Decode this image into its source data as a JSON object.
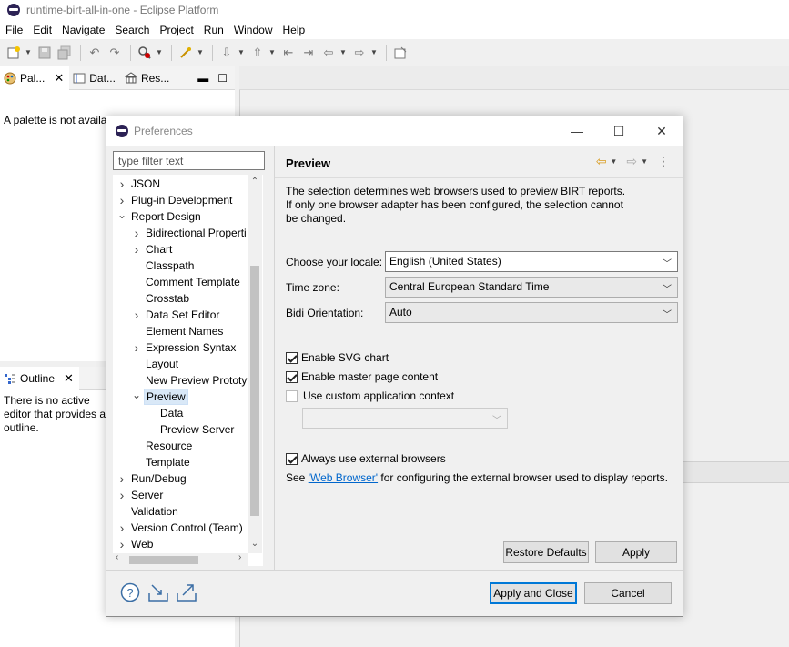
{
  "window": {
    "title": "runtime-birt-all-in-one - Eclipse Platform"
  },
  "menu": [
    "File",
    "Edit",
    "Navigate",
    "Search",
    "Project",
    "Run",
    "Window",
    "Help"
  ],
  "views": {
    "top_tabs": [
      {
        "label": "Pal...",
        "icon": "palette-icon"
      },
      {
        "label": "Dat...",
        "icon": "data-explorer-icon"
      },
      {
        "label": "Res...",
        "icon": "resource-explorer-icon"
      }
    ],
    "palette_message": "A palette is not availa",
    "outline_tab": "Outline",
    "outline_message": "There is no active editor that provides an outline."
  },
  "dialog": {
    "title": "Preferences",
    "filter_placeholder": "type filter text",
    "tree": [
      {
        "label": "JSON",
        "depth": 0,
        "arrow": "collapsed"
      },
      {
        "label": "Plug-in Development",
        "depth": 0,
        "arrow": "collapsed"
      },
      {
        "label": "Report Design",
        "depth": 0,
        "arrow": "expanded"
      },
      {
        "label": "Bidirectional Properti",
        "depth": 1,
        "arrow": "collapsed"
      },
      {
        "label": "Chart",
        "depth": 1,
        "arrow": "collapsed"
      },
      {
        "label": "Classpath",
        "depth": 1,
        "arrow": "none"
      },
      {
        "label": "Comment Template",
        "depth": 1,
        "arrow": "none"
      },
      {
        "label": "Crosstab",
        "depth": 1,
        "arrow": "none"
      },
      {
        "label": "Data Set Editor",
        "depth": 1,
        "arrow": "collapsed"
      },
      {
        "label": "Element Names",
        "depth": 1,
        "arrow": "none"
      },
      {
        "label": "Expression Syntax",
        "depth": 1,
        "arrow": "collapsed"
      },
      {
        "label": "Layout",
        "depth": 1,
        "arrow": "none"
      },
      {
        "label": "New Preview Prototyp",
        "depth": 1,
        "arrow": "none"
      },
      {
        "label": "Preview",
        "depth": 1,
        "arrow": "expanded",
        "selected": true
      },
      {
        "label": "Data",
        "depth": 2,
        "arrow": "none"
      },
      {
        "label": "Preview Server",
        "depth": 2,
        "arrow": "none"
      },
      {
        "label": "Resource",
        "depth": 1,
        "arrow": "none"
      },
      {
        "label": "Template",
        "depth": 1,
        "arrow": "none"
      },
      {
        "label": "Run/Debug",
        "depth": 0,
        "arrow": "collapsed"
      },
      {
        "label": "Server",
        "depth": 0,
        "arrow": "collapsed"
      },
      {
        "label": "Validation",
        "depth": 0,
        "arrow": "none"
      },
      {
        "label": "Version Control (Team)",
        "depth": 0,
        "arrow": "collapsed"
      },
      {
        "label": "Web",
        "depth": 0,
        "arrow": "collapsed"
      }
    ],
    "page": {
      "title": "Preview",
      "description_1": "The selection determines web browsers used to preview BIRT reports.",
      "description_2": "If only one browser adapter has been configured, the selection cannot",
      "description_3": "be changed.",
      "locale_label": "Choose your locale:",
      "locale_value": "English (United States)",
      "timezone_label": "Time zone:",
      "timezone_value": "Central European Standard Time",
      "bidi_label": "Bidi Orientation:",
      "bidi_value": "Auto",
      "enable_svg": {
        "label": "Enable SVG chart",
        "checked": true
      },
      "enable_master": {
        "label": "Enable master page content",
        "checked": true
      },
      "custom_context": {
        "label": "Use custom application context",
        "checked": false
      },
      "custom_context_value": "",
      "external_browsers": {
        "label": "Always use external browsers",
        "checked": true
      },
      "see_prefix": "See ",
      "see_link": "'Web Browser'",
      "see_suffix": " for configuring the external browser used to display reports.",
      "restore_defaults": "Restore Defaults",
      "apply": "Apply"
    },
    "apply_and_close": "Apply and Close",
    "cancel": "Cancel"
  },
  "colors": {
    "accent": "#0078d7",
    "link": "#0066cc",
    "selection": "#d9e8f7"
  }
}
